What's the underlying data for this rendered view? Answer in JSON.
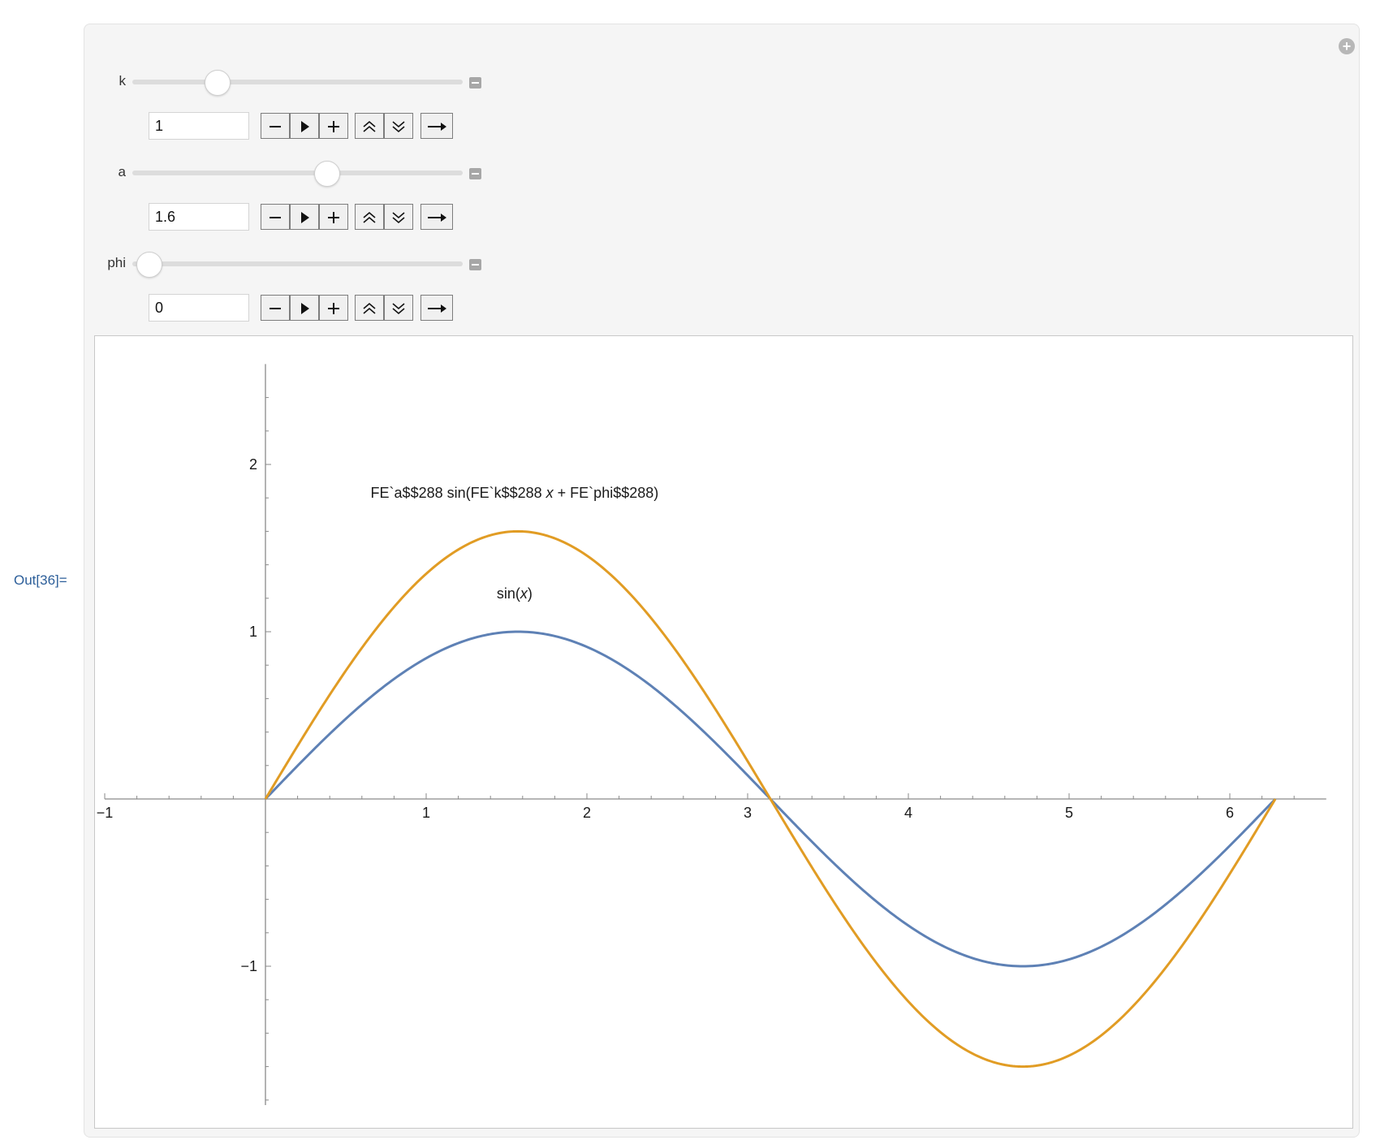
{
  "output_label": "Out[36]=",
  "controls": [
    {
      "name": "k",
      "value": "1",
      "slider_fraction": 0.26
    },
    {
      "name": "a",
      "value": "1.6",
      "slider_fraction": 0.59
    },
    {
      "name": "phi",
      "value": "0",
      "slider_fraction": 0.05
    }
  ],
  "icons": {
    "panel_add": "plus-circle-icon",
    "decrement": "minus-icon",
    "play": "play-icon",
    "increment": "plus-icon",
    "faster": "double-chevron-up-icon",
    "slower": "double-chevron-down-icon",
    "direction": "arrow-right-icon",
    "collapse": "minus-box-icon"
  },
  "colors": {
    "series_primary": "#5e81b5",
    "series_secondary": "#e19c24",
    "output_label": "#2d5f9a"
  },
  "chart_data": {
    "type": "line",
    "title": "",
    "xlabel": "",
    "ylabel": "",
    "xlim": [
      -1,
      6.6
    ],
    "ylim": [
      -1.83,
      2.6
    ],
    "x_ticks": [
      -1,
      1,
      2,
      3,
      4,
      5,
      6
    ],
    "x_tick_labels": [
      "-1",
      "1",
      "2",
      "3",
      "4",
      "5",
      "6"
    ],
    "y_ticks": [
      -1,
      1,
      2
    ],
    "y_tick_labels": [
      "-1",
      "1",
      "2"
    ],
    "grid": false,
    "series": [
      {
        "name": "sin(x)",
        "color": "#5e81b5",
        "x": [
          0,
          0.5236,
          1.0472,
          1.5708,
          2.0944,
          2.618,
          3.1416,
          3.6652,
          4.1888,
          4.7124,
          5.236,
          5.7596,
          6.2832
        ],
        "y": [
          0,
          0.5,
          0.866,
          1,
          0.866,
          0.5,
          0,
          -0.5,
          -0.866,
          -1,
          -0.866,
          -0.5,
          0
        ]
      },
      {
        "name": "FE`a$$288 sin(FE`k$$288 x + FE`phi$$288)",
        "color": "#e19c24",
        "x": [
          0,
          0.5236,
          1.0472,
          1.5708,
          2.0944,
          2.618,
          3.1416,
          3.6652,
          4.1888,
          4.7124,
          5.236,
          5.7596,
          6.2832
        ],
        "y": [
          0,
          0.8,
          1.386,
          1.6,
          1.386,
          0.8,
          0,
          -0.8,
          -1.386,
          -1.6,
          -1.386,
          -0.8,
          0
        ]
      }
    ],
    "annotations": [
      {
        "text_parts": [
          "FE`a$$288 sin(FE`k$$288 ",
          "x",
          " + FE`phi$$288)"
        ],
        "anchor_x": 1.55,
        "anchor_y": 1.8
      },
      {
        "text_parts": [
          "sin(",
          "x",
          ")"
        ],
        "anchor_x": 1.55,
        "anchor_y": 1.2
      }
    ]
  }
}
